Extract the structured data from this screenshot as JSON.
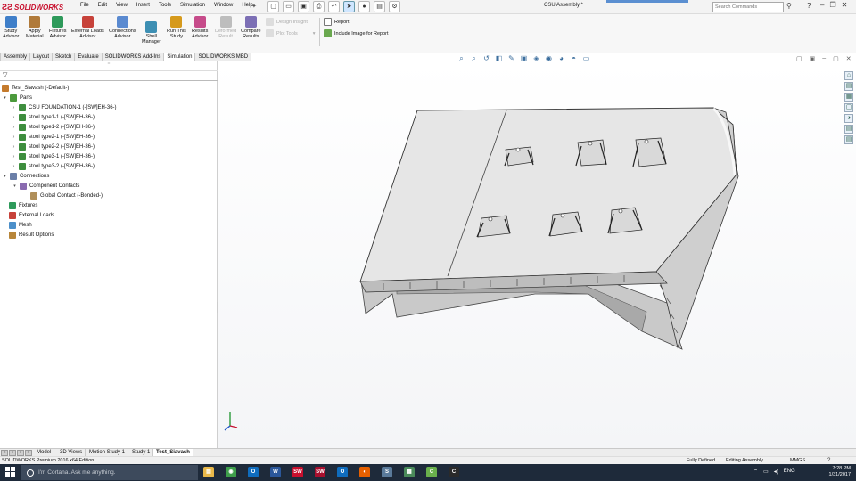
{
  "app": {
    "logo_text": "SOLIDWORKS",
    "document_title": "CSU Assembly *"
  },
  "menu": [
    "File",
    "Edit",
    "View",
    "Insert",
    "Tools",
    "Simulation",
    "Window",
    "Help"
  ],
  "search": {
    "placeholder": "Search Commands"
  },
  "window_controls": {
    "help": "?",
    "minimize": "–",
    "restore": "❐",
    "close": "✕"
  },
  "command_manager": {
    "buttons": [
      {
        "label": "Study\nAdvisor",
        "color": "#3f7fc9"
      },
      {
        "label": "Apply\nMaterial",
        "color": "#b07a3a"
      },
      {
        "label": "Fixtures\nAdvisor",
        "color": "#2e9a5b"
      },
      {
        "label": "External Loads\nAdvisor",
        "color": "#c7423a"
      },
      {
        "label": "Connections\nAdvisor",
        "color": "#5a8ad0"
      },
      {
        "label": "Shell\nManager",
        "color": "#3d8fb3"
      },
      {
        "label": "Run This\nStudy",
        "color": "#d69a1c"
      },
      {
        "label": "Results\nAdvisor",
        "color": "#c64b8a"
      },
      {
        "label": "Deformed\nResult",
        "color": "#bdbdbd",
        "disabled": true
      },
      {
        "label": "Compare\nResults",
        "color": "#7c6fb5"
      }
    ],
    "design_insight": "Design Insight",
    "plot_tools": "Plot Tools",
    "report": "Report",
    "include_image": "Include Image for Report"
  },
  "tabs": [
    "Assembly",
    "Layout",
    "Sketch",
    "Evaluate",
    "SOLIDWORKS Add-Ins",
    "Simulation",
    "SOLIDWORKS MBD"
  ],
  "active_tab": "Simulation",
  "feature_tree": {
    "header_glyph": "⁼",
    "filter_icon": "filter-icon",
    "root": "Test_Siavash (-Default-)",
    "parts_label": "Parts",
    "parts": [
      "CSU FOUNDATION-1 (-[SW]EH-36-)",
      "stool type1-1 (-[SW]EH-36-)",
      "stool type1-2 (-[SW]EH-36-)",
      "stool type2-1 (-[SW]EH-36-)",
      "stool type2-2 (-[SW]EH-36-)",
      "stool type3-1 (-[SW]EH-36-)",
      "stool type3-2 (-[SW]EH-36-)"
    ],
    "connections": "Connections",
    "component_contacts": "Component Contacts",
    "global_contact": "Global Contact (-Bonded-)",
    "fixtures": "Fixtures",
    "external_loads": "External Loads",
    "mesh": "Mesh",
    "result_options": "Result Options"
  },
  "bottom_tabs": [
    "Model",
    "3D Views",
    "Motion Study 1",
    "Study 1",
    "Test_Siavash"
  ],
  "active_bottom_tab": "Test_Siavash",
  "status": {
    "edition": "SOLIDWORKS Premium 2016 x64 Edition",
    "definition": "Fully Defined",
    "mode": "Editing Assembly",
    "units": "MMGS",
    "help": "?"
  },
  "taskbar": {
    "cortana_placeholder": "I'm Cortana. Ask me anything.",
    "apps": [
      {
        "name": "file-explorer",
        "glyph": "▤",
        "color": "#e8b84a"
      },
      {
        "name": "chrome",
        "glyph": "◉",
        "color": "#3e9e4b"
      },
      {
        "name": "outlook",
        "glyph": "O",
        "color": "#0f6cbd"
      },
      {
        "name": "word",
        "glyph": "W",
        "color": "#2b579a"
      },
      {
        "name": "solidworks",
        "glyph": "SW",
        "color": "#c8102e"
      },
      {
        "name": "solidworks-2",
        "glyph": "SW",
        "color": "#a8102e"
      },
      {
        "name": "outlook-2",
        "glyph": "O",
        "color": "#0f6cbd"
      },
      {
        "name": "firefox",
        "glyph": "◐",
        "color": "#e66000"
      },
      {
        "name": "app-s",
        "glyph": "S",
        "color": "#5a7a9a"
      },
      {
        "name": "app-chart",
        "glyph": "▦",
        "color": "#4a8a5a"
      },
      {
        "name": "app-c-green",
        "glyph": "C",
        "color": "#6ab04c"
      },
      {
        "name": "app-c-white",
        "glyph": "C",
        "color": "#2a2a2a"
      }
    ],
    "language": "ENG",
    "time": "7:28 PM",
    "date": "1/31/2017"
  }
}
